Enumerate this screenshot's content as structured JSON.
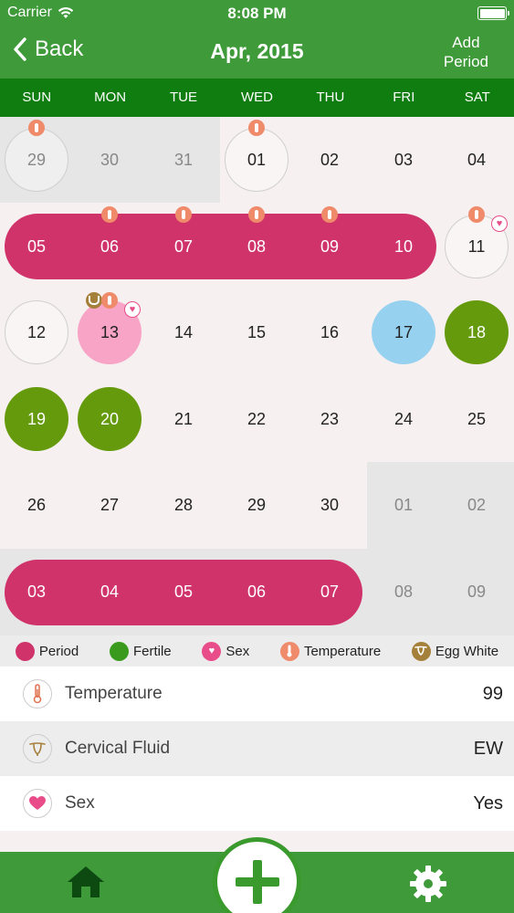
{
  "status_bar": {
    "carrier": "Carrier",
    "time": "8:08 PM"
  },
  "nav": {
    "back_label": "Back",
    "title": "Apr, 2015",
    "add_period_line1": "Add",
    "add_period_line2": "Period"
  },
  "weekdays": [
    "SUN",
    "MON",
    "TUE",
    "WED",
    "THU",
    "FRI",
    "SAT"
  ],
  "calendar": {
    "rows": [
      [
        "29",
        "30",
        "31",
        "01",
        "02",
        "03",
        "04"
      ],
      [
        "05",
        "06",
        "07",
        "08",
        "09",
        "10",
        "11"
      ],
      [
        "12",
        "13",
        "14",
        "15",
        "16",
        "17",
        "18"
      ],
      [
        "19",
        "20",
        "21",
        "22",
        "23",
        "24",
        "25"
      ],
      [
        "26",
        "27",
        "28",
        "29",
        "30",
        "01",
        "02"
      ],
      [
        "03",
        "04",
        "05",
        "06",
        "07",
        "08",
        "09"
      ]
    ]
  },
  "legend": {
    "period": "Period",
    "fertile": "Fertile",
    "sex": "Sex",
    "temperature": "Temperature",
    "egg_white": "Egg White"
  },
  "details": {
    "temperature": {
      "label": "Temperature",
      "value": "99"
    },
    "cervical_fluid": {
      "label": "Cervical Fluid",
      "value": "EW"
    },
    "sex": {
      "label": "Sex",
      "value": "Yes"
    }
  },
  "colors": {
    "header_green": "#3f9a3a",
    "weekday_green": "#0f7d0f",
    "period_pink": "#d0336a",
    "fertile_green": "#649a0c",
    "ovulation_blue": "#96d1f0",
    "selected_pink": "#f7a4c7",
    "temperature_orange": "#ef8a6a",
    "egg_white_brown": "#a5803a",
    "sex_pink": "#e84d8a"
  }
}
